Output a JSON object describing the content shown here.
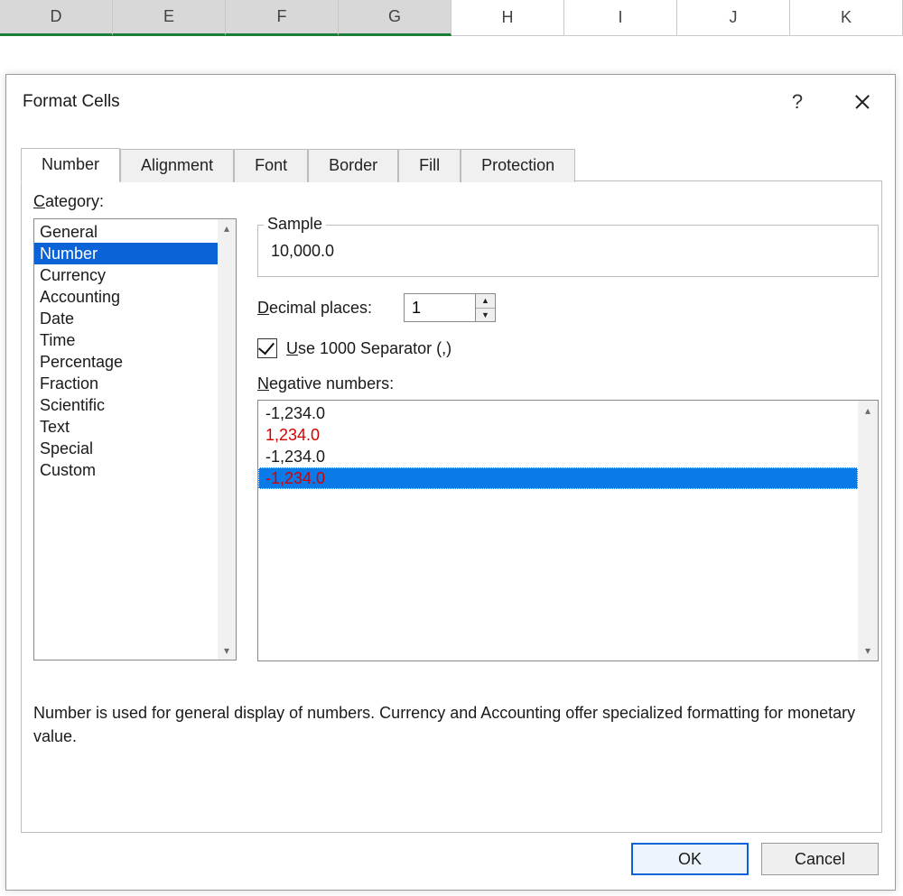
{
  "columns": [
    "D",
    "E",
    "F",
    "G",
    "H",
    "I",
    "J",
    "K"
  ],
  "selected_columns": [
    "D",
    "E",
    "F",
    "G"
  ],
  "dialog": {
    "title": "Format Cells",
    "tabs": [
      "Number",
      "Alignment",
      "Font",
      "Border",
      "Fill",
      "Protection"
    ],
    "active_tab": "Number",
    "category_label": "Category:",
    "categories": [
      "General",
      "Number",
      "Currency",
      "Accounting",
      "Date",
      "Time",
      "Percentage",
      "Fraction",
      "Scientific",
      "Text",
      "Special",
      "Custom"
    ],
    "category_selected": "Number",
    "sample_label": "Sample",
    "sample_value": "10,000.0",
    "decimal_label": "Decimal places:",
    "decimal_value": "1",
    "separator_checked": true,
    "separator_label": "Use 1000 Separator (,)",
    "negative_label": "Negative numbers:",
    "negative_options": [
      {
        "text": "-1,234.0",
        "red": false
      },
      {
        "text": "1,234.0",
        "red": true
      },
      {
        "text": "-1,234.0",
        "red": false
      },
      {
        "text": "-1,234.0",
        "red": true
      }
    ],
    "negative_selected_index": 3,
    "description": "Number is used for general display of numbers.  Currency and Accounting offer specialized formatting for monetary value.",
    "ok_label": "OK",
    "cancel_label": "Cancel",
    "help_symbol": "?"
  }
}
